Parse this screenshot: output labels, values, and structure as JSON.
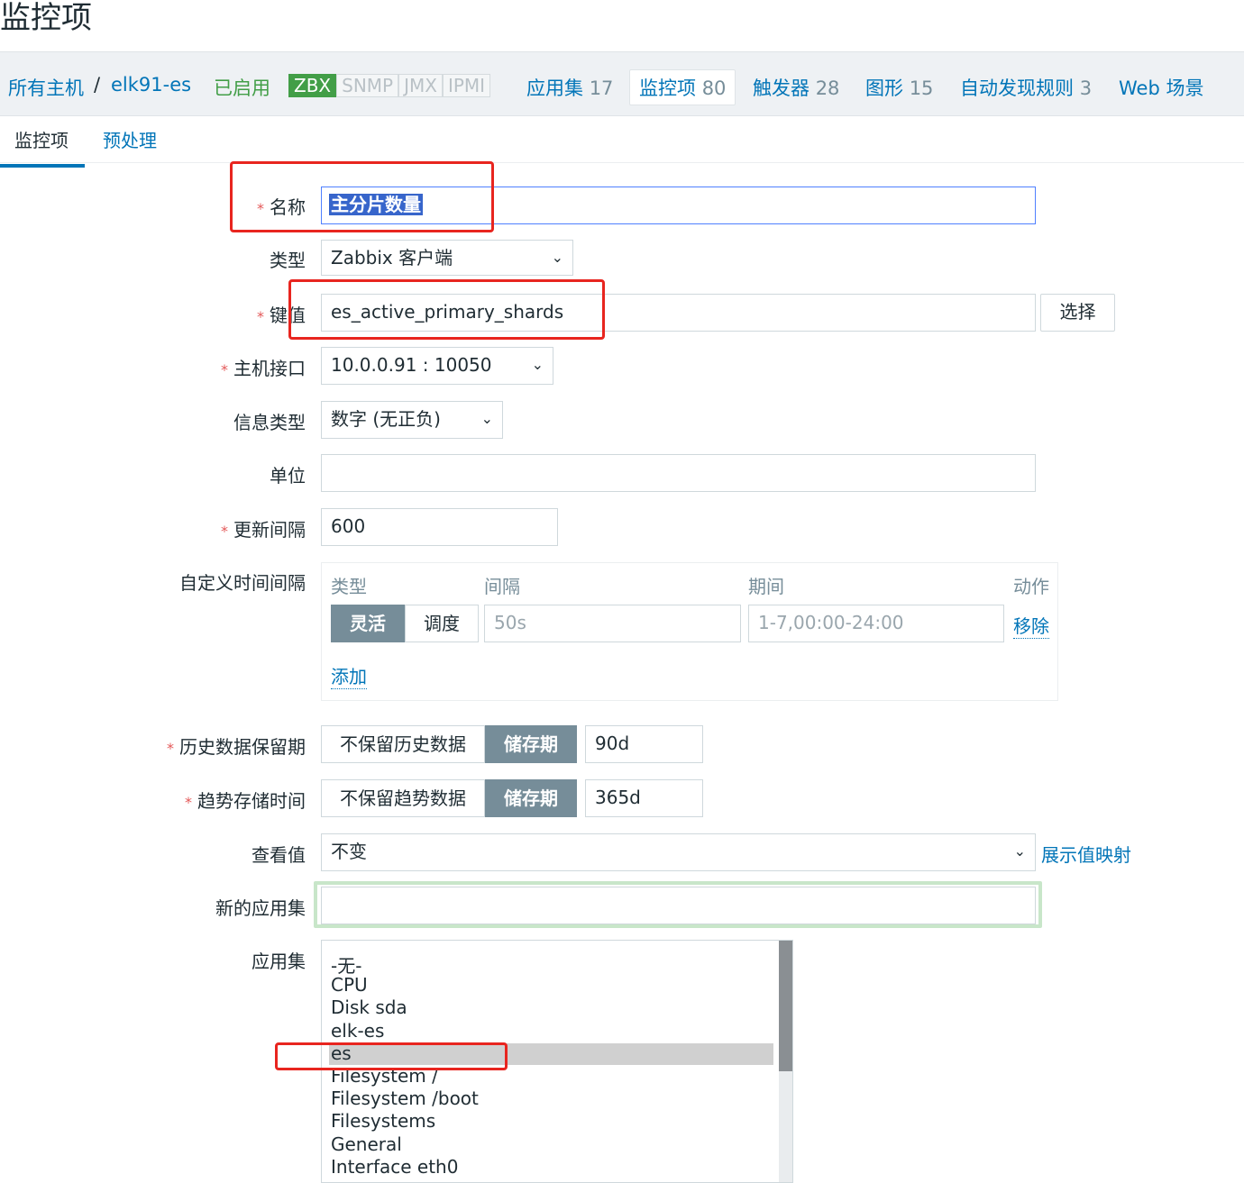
{
  "page_title": "监控项",
  "host_bar": {
    "all_hosts": "所有主机",
    "separator": "/",
    "host": "elk91-es",
    "status": "已启用",
    "availability": [
      "ZBX",
      "SNMP",
      "JMX",
      "IPMI"
    ],
    "links": [
      {
        "label": "应用集",
        "count": "17"
      },
      {
        "label": "监控项",
        "count": "80",
        "active": true
      },
      {
        "label": "触发器",
        "count": "28"
      },
      {
        "label": "图形",
        "count": "15"
      },
      {
        "label": "自动发现规则",
        "count": "3"
      },
      {
        "label": "Web 场景",
        "count": ""
      }
    ]
  },
  "tabs": [
    {
      "label": "监控项",
      "active": true
    },
    {
      "label": "预处理",
      "active": false
    }
  ],
  "form": {
    "required_mark": "*",
    "name": {
      "label": "名称",
      "value": "主分片数量"
    },
    "type": {
      "label": "类型",
      "value": "Zabbix 客户端"
    },
    "key": {
      "label": "键值",
      "value": "es_active_primary_shards",
      "select_button": "选择"
    },
    "interface": {
      "label": "主机接口",
      "value": "10.0.0.91 : 10050"
    },
    "value_type": {
      "label": "信息类型",
      "value": "数字 (无正负)"
    },
    "units": {
      "label": "单位",
      "value": ""
    },
    "update_interval": {
      "label": "更新间隔",
      "value": "600"
    },
    "custom_intervals": {
      "label": "自定义时间间隔",
      "headers": {
        "type": "类型",
        "interval": "间隔",
        "period": "期间",
        "action": "动作"
      },
      "row": {
        "flexible": "灵活",
        "scheduling": "调度",
        "interval_placeholder": "50s",
        "period_placeholder": "1-7,00:00-24:00",
        "remove": "移除"
      },
      "add": "添加"
    },
    "history": {
      "label": "历史数据保留期",
      "no_keep": "不保留历史数据",
      "store": "储存期",
      "value": "90d"
    },
    "trends": {
      "label": "趋势存储时间",
      "no_keep": "不保留趋势数据",
      "store": "储存期",
      "value": "365d"
    },
    "show_value": {
      "label": "查看值",
      "value": "不变",
      "link": "展示值映射"
    },
    "new_application": {
      "label": "新的应用集",
      "value": ""
    },
    "applications": {
      "label": "应用集",
      "items": [
        "-无-",
        "CPU",
        "Disk sda",
        "elk-es",
        "es",
        "Filesystem /",
        "Filesystem /boot",
        "Filesystems",
        "General",
        "Interface eth0"
      ],
      "selected": "es"
    }
  },
  "colors": {
    "link": "#0275b8",
    "annotation_red": "#e8251f",
    "green": "#429e47",
    "segment_on": "#768d99"
  }
}
